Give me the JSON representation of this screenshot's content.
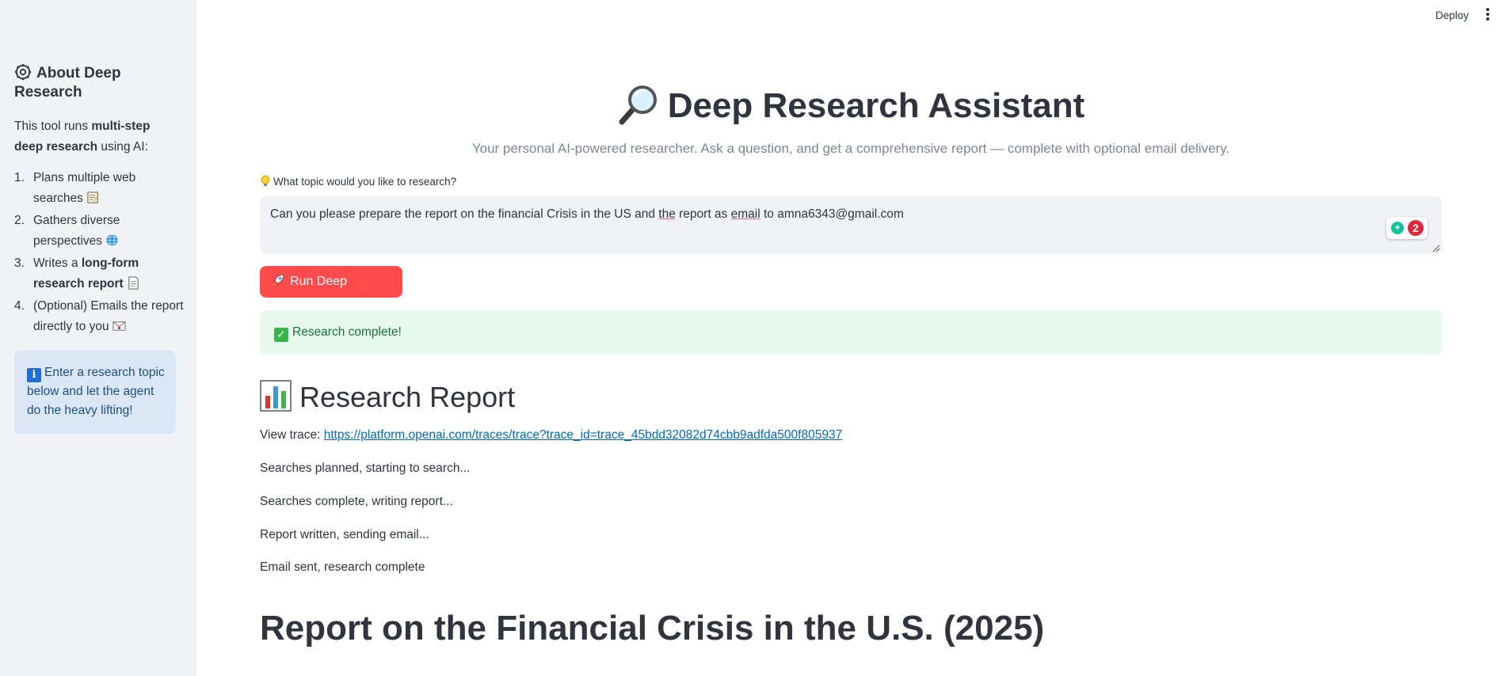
{
  "header": {
    "deploy_label": "Deploy"
  },
  "sidebar": {
    "title": "About Deep Research",
    "intro_prefix": "This tool runs ",
    "intro_bold": "multi-step deep research",
    "intro_suffix": " using AI:",
    "steps": [
      {
        "num": "1.",
        "text": "Plans multiple web searches",
        "icon": "memo-icon"
      },
      {
        "num": "2.",
        "text": "Gathers diverse perspectives",
        "icon": "globe-icon"
      },
      {
        "num": "3.",
        "prefix": "Writes a ",
        "bold": "long-form research report",
        "icon": "document-icon"
      },
      {
        "num": "4.",
        "text": "(Optional) Emails the report directly to you",
        "icon": "envelope-icon"
      }
    ],
    "info_text": "Enter a research topic below and let the agent do the heavy lifting!"
  },
  "main": {
    "title": "Deep Research Assistant",
    "subtitle": "Your personal AI-powered researcher. Ask a question, and get a comprehensive report — complete with optional email delivery.",
    "query_label": "What topic would you like to research?",
    "query_value_parts": [
      "Can you please prepare the report on the financial Crisis in the US and ",
      "the",
      " report as ",
      "email",
      " to amna6343@gmail.com"
    ],
    "grammarly_count": "2",
    "run_button_label": "Run Deep Research",
    "success_text": "Research complete!",
    "report_heading": "Research Report",
    "trace_label": "View trace: ",
    "trace_url": "https://platform.openai.com/traces/trace?trace_id=trace_45bdd32082d74cbb9adfda500f805937",
    "log_lines": [
      "Searches planned, starting to search...",
      "Searches complete, writing report...",
      "Report written, sending email...",
      "Email sent, research complete"
    ],
    "report_title": "Report on the Financial Crisis in the U.S. (2025)"
  },
  "colors": {
    "accent": "#ff4b4b",
    "sidebar_bg": "#f0f2f6",
    "success_bg": "#e6f9ec",
    "info_bg": "#dbe7f5",
    "link": "#0068c9"
  }
}
